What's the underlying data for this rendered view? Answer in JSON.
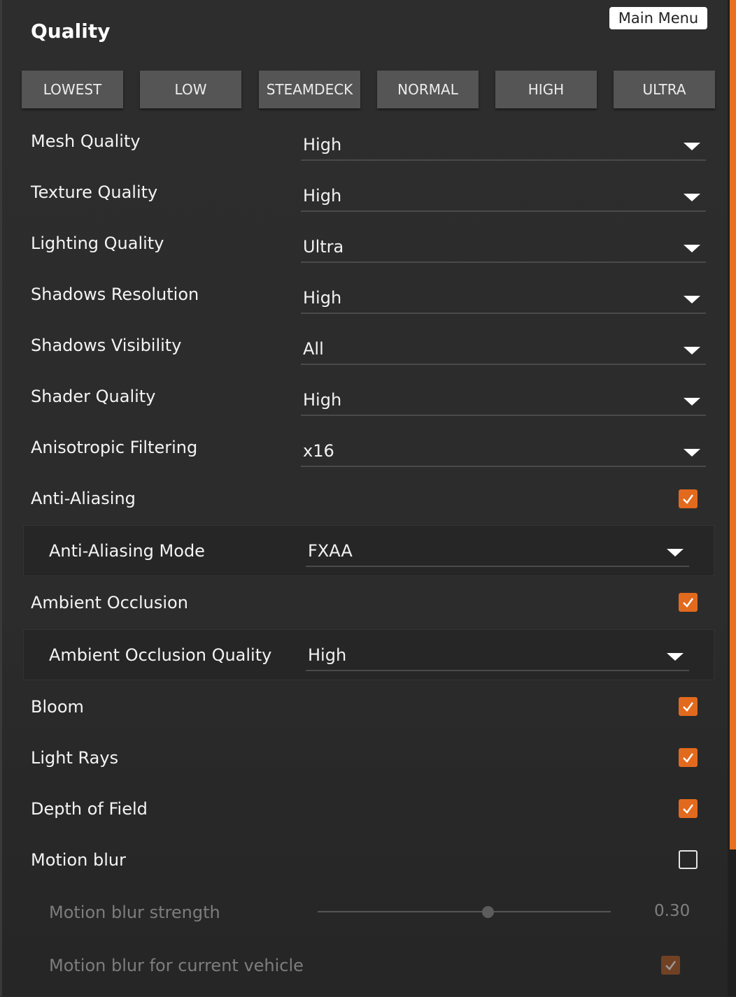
{
  "panel": {
    "title": "Quality",
    "main_menu_label": "Main Menu"
  },
  "presets": [
    "LOWEST",
    "LOW",
    "STEAMDECK",
    "NORMAL",
    "HIGH",
    "ULTRA"
  ],
  "settings": {
    "mesh_quality": {
      "label": "Mesh Quality",
      "value": "High"
    },
    "texture_quality": {
      "label": "Texture Quality",
      "value": "High"
    },
    "lighting_quality": {
      "label": "Lighting Quality",
      "value": "Ultra"
    },
    "shadows_resolution": {
      "label": "Shadows Resolution",
      "value": "High"
    },
    "shadows_visibility": {
      "label": "Shadows Visibility",
      "value": "All"
    },
    "shader_quality": {
      "label": "Shader Quality",
      "value": "High"
    },
    "anisotropic_filtering": {
      "label": "Anisotropic Filtering",
      "value": "x16"
    },
    "anti_aliasing": {
      "label": "Anti-Aliasing",
      "checked": true
    },
    "anti_aliasing_mode": {
      "label": "Anti-Aliasing Mode",
      "value": "FXAA"
    },
    "ambient_occlusion": {
      "label": "Ambient Occlusion",
      "checked": true
    },
    "ambient_occlusion_quality": {
      "label": "Ambient Occlusion Quality",
      "value": "High"
    },
    "bloom": {
      "label": "Bloom",
      "checked": true
    },
    "light_rays": {
      "label": "Light Rays",
      "checked": true
    },
    "depth_of_field": {
      "label": "Depth of Field",
      "checked": true
    },
    "motion_blur": {
      "label": "Motion blur",
      "checked": false
    },
    "motion_blur_strength": {
      "label": "Motion blur strength",
      "value": "0.30",
      "fraction": 0.58
    },
    "motion_blur_current_vehicle": {
      "label": "Motion blur for current vehicle",
      "checked": true
    }
  },
  "colors": {
    "accent": "#e26a1e",
    "background": "#2c2c2c",
    "button": "#555555"
  },
  "icons": {
    "dropdown": "caret-down-icon",
    "check": "checkmark-icon"
  }
}
